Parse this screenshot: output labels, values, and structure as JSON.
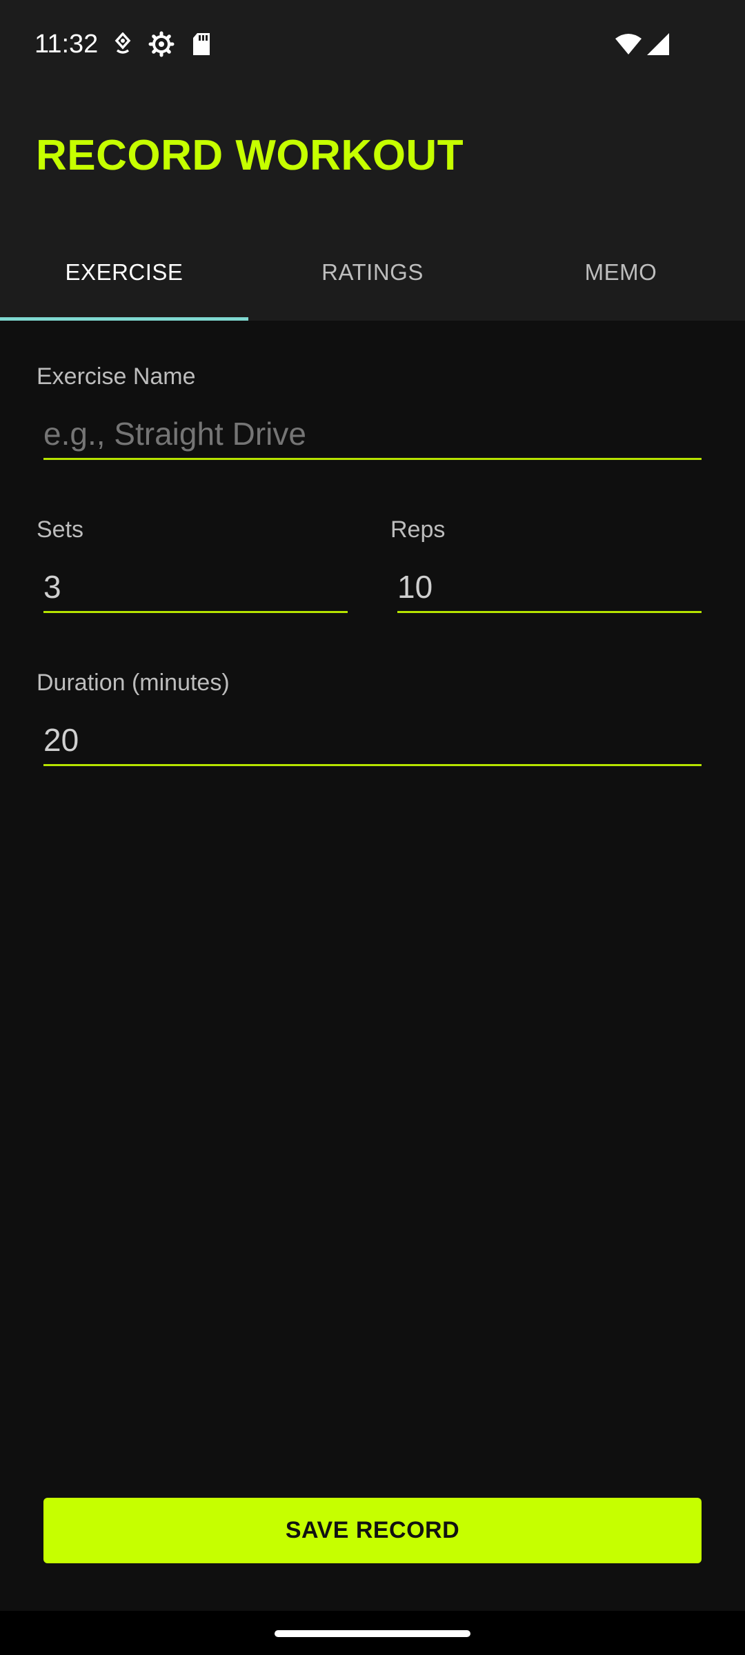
{
  "status_bar": {
    "time": "11:32",
    "icons": [
      "location-icon",
      "gear-icon",
      "sd-card-icon",
      "wifi-icon",
      "signal-icon"
    ]
  },
  "app_bar": {
    "title": "RECORD WORKOUT",
    "accent_color": "#c6ff00"
  },
  "tabs": [
    {
      "label": "EXERCISE",
      "active": true
    },
    {
      "label": "RATINGS",
      "active": false
    },
    {
      "label": "MEMO",
      "active": false
    }
  ],
  "form": {
    "exercise_name": {
      "label": "Exercise Name",
      "placeholder": "e.g., Straight Drive",
      "value": ""
    },
    "sets": {
      "label": "Sets",
      "value": "3"
    },
    "reps": {
      "label": "Reps",
      "value": "10"
    },
    "duration": {
      "label": "Duration (minutes)",
      "value": "20"
    }
  },
  "actions": {
    "save_label": "SAVE RECORD"
  }
}
